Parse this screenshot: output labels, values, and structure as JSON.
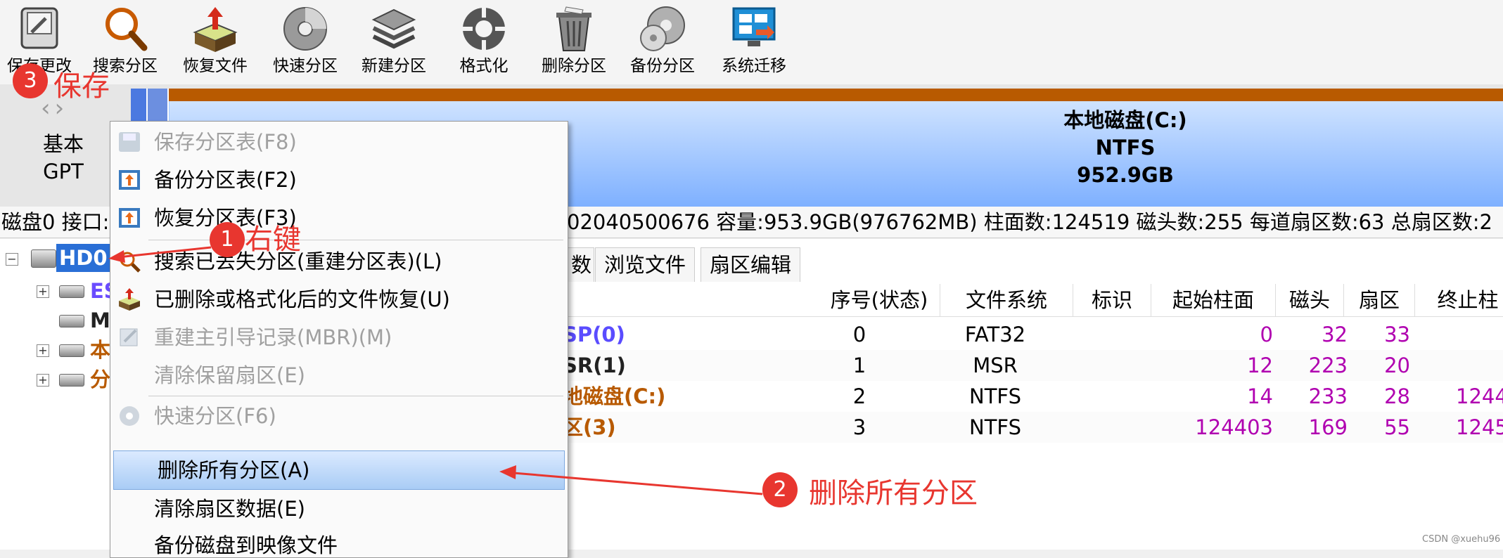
{
  "toolbar": {
    "items": [
      {
        "label": "保存更改",
        "icon": "save-changes-icon"
      },
      {
        "label": "搜索分区",
        "icon": "search-icon"
      },
      {
        "label": "恢复文件",
        "icon": "recover-file-icon"
      },
      {
        "label": "快速分区",
        "icon": "quick-partition-icon"
      },
      {
        "label": "新建分区",
        "icon": "new-partition-icon"
      },
      {
        "label": "格式化",
        "icon": "format-icon"
      },
      {
        "label": "删除分区",
        "icon": "delete-partition-icon"
      },
      {
        "label": "备份分区",
        "icon": "backup-partition-icon"
      },
      {
        "label": "系统迁移",
        "icon": "system-migration-icon"
      }
    ]
  },
  "disk_bar": {
    "type_line1": "基本",
    "type_line2": "GPT",
    "main_partition": {
      "name": "本地磁盘(C:)",
      "fs": "NTFS",
      "size": "952.9GB"
    }
  },
  "disk_info": {
    "left": "磁盘0 接口:",
    "right": "02040500676  容量:953.9GB(976762MB)  柱面数:124519  磁头数:255  每道扇区数:63  总扇区数:2"
  },
  "tree": {
    "root": "HD0",
    "children": [
      {
        "label": "ES",
        "color": "#6a4cff",
        "expander": "+"
      },
      {
        "label": "M",
        "color": "#222222",
        "expander": ""
      },
      {
        "label": "本",
        "color": "#b85a00",
        "expander": "+"
      },
      {
        "label": "分",
        "color": "#b85a00",
        "expander": "+"
      }
    ]
  },
  "tabs": [
    "数",
    "浏览文件",
    "扇区编辑"
  ],
  "table": {
    "headers": [
      "序号(状态)",
      "文件系统",
      "标识",
      "起始柱面",
      "磁头",
      "扇区",
      "终止柱"
    ],
    "rows": [
      {
        "name": "SP(0)",
        "name_color": "#5a4cff",
        "idx": "0",
        "fs": "FAT32",
        "cyl": "0",
        "head": "32",
        "sec": "33",
        "end": ""
      },
      {
        "name": "SR(1)",
        "name_color": "#222222",
        "idx": "1",
        "fs": "MSR",
        "cyl": "12",
        "head": "223",
        "sec": "20",
        "end": ""
      },
      {
        "name": "地磁盘(C:)",
        "name_color": "#b85a00",
        "idx": "2",
        "fs": "NTFS",
        "cyl": "14",
        "head": "233",
        "sec": "28",
        "end": "1244"
      },
      {
        "name": "区(3)",
        "name_color": "#b85a00",
        "idx": "3",
        "fs": "NTFS",
        "cyl": "124403",
        "head": "169",
        "sec": "55",
        "end": "1245"
      }
    ]
  },
  "context_menu": {
    "items": [
      {
        "label": "保存分区表(F8)",
        "disabled": true,
        "icon": "save-icon"
      },
      {
        "label": "备份分区表(F2)",
        "disabled": false,
        "icon": "backup-table-icon"
      },
      {
        "label": "恢复分区表(F3)",
        "disabled": false,
        "icon": "restore-table-icon"
      },
      {
        "label": "搜索已丢失分区(重建分区表)(L)",
        "disabled": false,
        "icon": "search-icon"
      },
      {
        "label": "已删除或格式化后的文件恢复(U)",
        "disabled": false,
        "icon": "recover-file-icon"
      },
      {
        "label": "重建主引导记录(MBR)(M)",
        "disabled": true,
        "icon": "rebuild-mbr-icon"
      },
      {
        "label": "清除保留扇区(E)",
        "disabled": true,
        "icon": ""
      },
      {
        "label": "快速分区(F6)",
        "disabled": true,
        "icon": "quick-partition-icon"
      },
      {
        "label": "删除所有分区(A)",
        "disabled": false,
        "selected": true,
        "icon": ""
      },
      {
        "label": "清除扇区数据(E)",
        "disabled": false,
        "icon": ""
      },
      {
        "label": "备份磁盘到映像文件",
        "disabled": false,
        "icon": ""
      }
    ]
  },
  "annotations": {
    "step1": {
      "num": "1",
      "text": "右键"
    },
    "step2": {
      "num": "2",
      "text": "删除所有分区"
    },
    "step3": {
      "num": "3",
      "text": "保存"
    }
  },
  "watermark": "CSDN @xuehu96",
  "colors": {
    "annotation_red": "#e8362f",
    "partition_orange": "#b85a00",
    "partition_blue": "#7eb0ff",
    "value_magenta": "#b000b0"
  }
}
